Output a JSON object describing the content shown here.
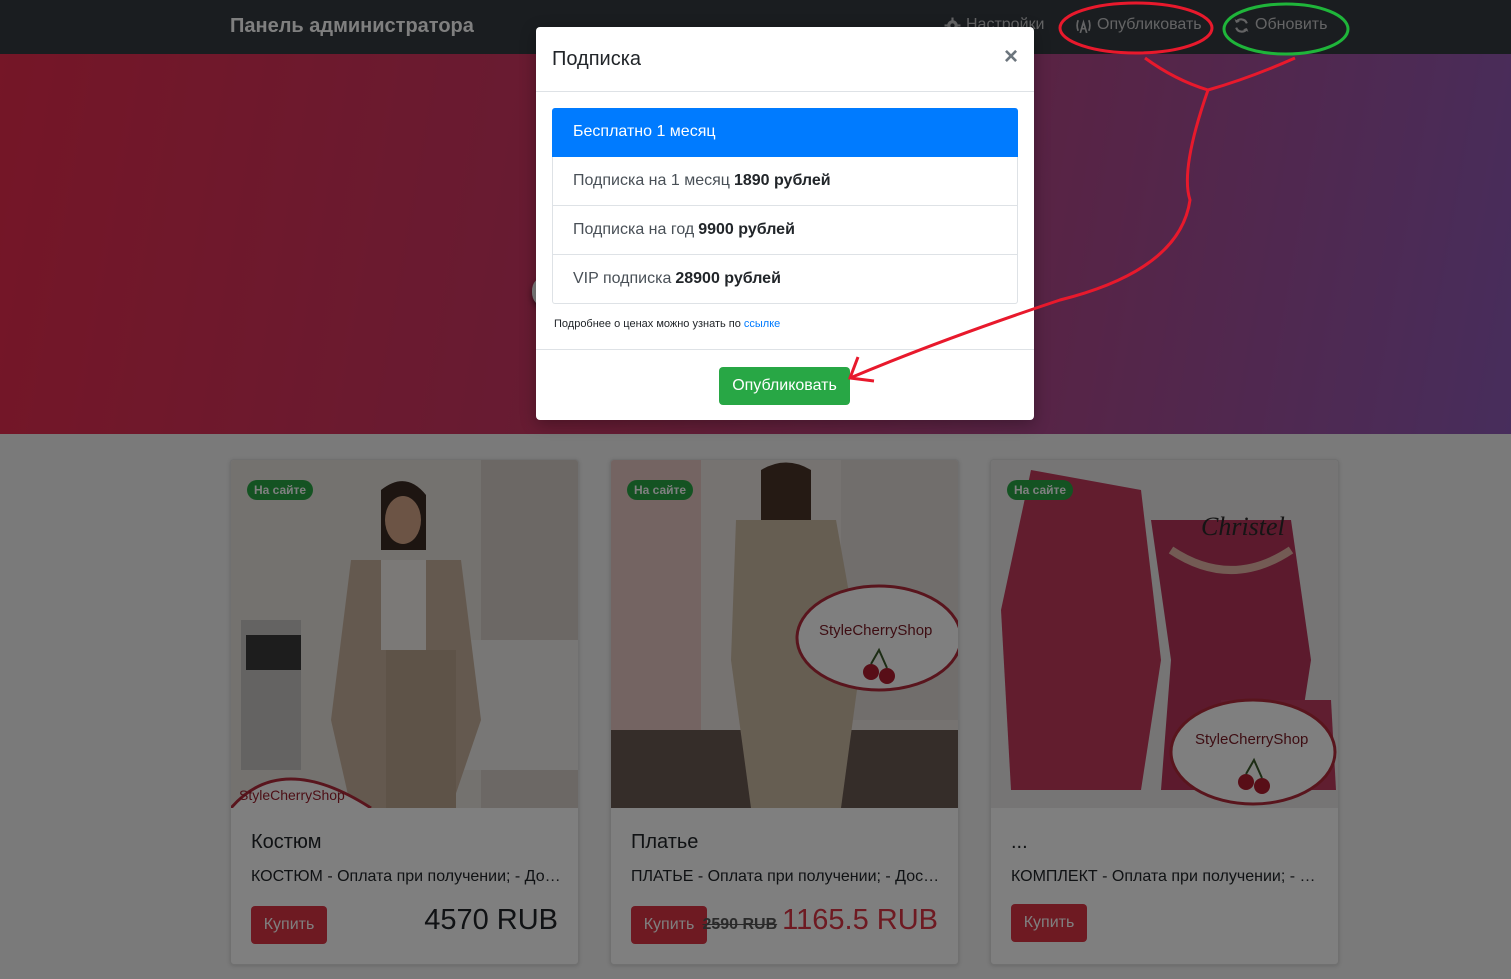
{
  "navbar": {
    "brand": "Панель администратора",
    "settings": "Настройки",
    "publish": "Опубликовать",
    "refresh": "Обновить"
  },
  "hero": {
    "title": "СТИЛЬНАЯ ОДЕЖДА"
  },
  "products": [
    {
      "badge": "На сайте",
      "title": "Костюм",
      "description": "КОСТЮМ - Оплата при получении; - Доставка по всей России",
      "buy": "Купить",
      "price": "4570 RUB",
      "watermark": "StyleCherryShop"
    },
    {
      "badge": "На сайте",
      "title": "Платье",
      "description": "ПЛАТЬЕ - Оплата при получении; - Доставка по всей России",
      "buy": "Купить",
      "old_price": "2590 RUB",
      "sale_price": "1165.5 RUB",
      "watermark": "StyleCherryShop"
    },
    {
      "badge": "На сайте",
      "title": "...",
      "description": "КОМПЛЕКТ - Оплата при получении; - Доставка",
      "buy": "Купить",
      "watermark": "StyleCherryShop",
      "brand_mark": "Christel"
    }
  ],
  "modal": {
    "title": "Подписка",
    "close": "×",
    "options": [
      {
        "label": "Бесплатно 1 месяц",
        "price": "",
        "active": true
      },
      {
        "label": "Подписка на 1 месяц",
        "price": "1890 рублей",
        "active": false
      },
      {
        "label": "Подписка на год",
        "price": "9900 рублей",
        "active": false
      },
      {
        "label": "VIP подписка",
        "price": "28900 рублей",
        "active": false
      }
    ],
    "note_text": "Подробнее о ценах можно узнать по",
    "note_link": "ссылке",
    "publish_button": "Опубликовать"
  },
  "colors": {
    "navbar": "#343a40",
    "primary": "#007bff",
    "success": "#28a745",
    "danger": "#dc3545",
    "annotation_red": "#e8192c",
    "annotation_green": "#1fb53a"
  }
}
